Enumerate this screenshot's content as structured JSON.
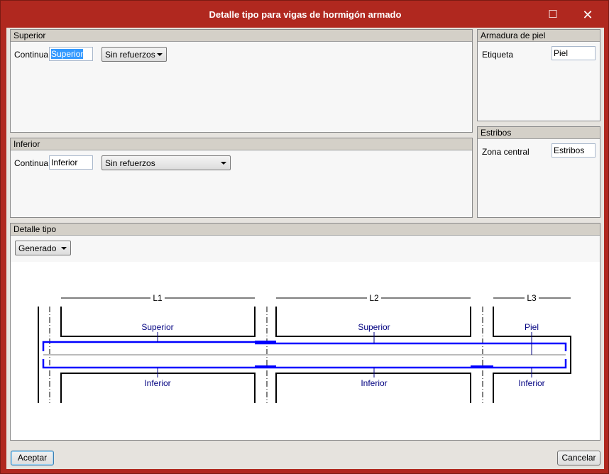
{
  "window": {
    "title": "Detalle tipo para vigas de hormigón armado",
    "maximize_icon": "maximize-icon",
    "close_icon": "close-icon"
  },
  "superior": {
    "header": "Superior",
    "label": "Continua",
    "value": "Superior",
    "select": "Sin refuerzos"
  },
  "inferior": {
    "header": "Inferior",
    "label": "Continua",
    "value": "Inferior",
    "select": "Sin refuerzos"
  },
  "armadura_piel": {
    "header": "Armadura de piel",
    "label": "Etiqueta",
    "value": "Piel"
  },
  "estribos": {
    "header": "Estribos",
    "label": "Zona central",
    "value": "Estribos"
  },
  "detalle": {
    "header": "Detalle tipo",
    "select": "Generado",
    "drawing": {
      "spans": [
        "L1",
        "L2",
        "L3"
      ],
      "top_labels": [
        "Superior",
        "Superior",
        "Piel"
      ],
      "bottom_labels": [
        "Inferior",
        "Inferior",
        "Inferior"
      ],
      "rebar_color": "#0000ff",
      "label_color": "#000080"
    }
  },
  "buttons": {
    "accept": "Aceptar",
    "cancel": "Cancelar"
  }
}
